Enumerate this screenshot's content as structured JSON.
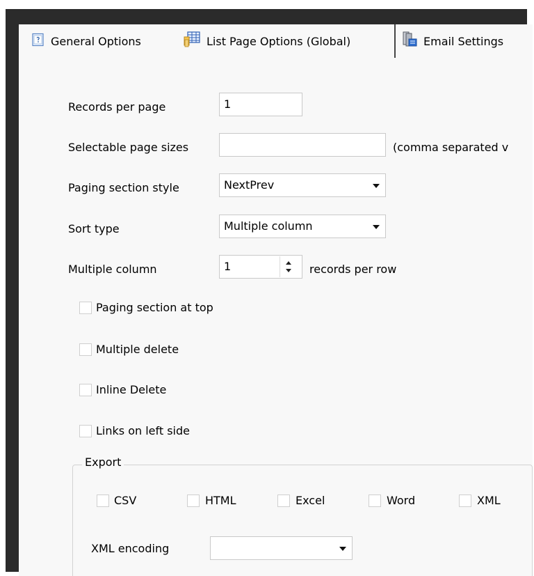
{
  "tabs": [
    {
      "label": "General Options",
      "icon": "document-help-icon"
    },
    {
      "label": "List Page Options (Global)",
      "icon": "grid-table-icon"
    },
    {
      "label": "Email Settings",
      "icon": "email-server-icon"
    }
  ],
  "form": {
    "records_per_page": {
      "label": "Records per page",
      "value": "1"
    },
    "selectable_page_sizes": {
      "label": "Selectable page sizes",
      "value": "",
      "hint": "(comma separated v"
    },
    "paging_section_style": {
      "label": "Paging section style",
      "value": "NextPrev"
    },
    "sort_type": {
      "label": "Sort type",
      "value": "Multiple column"
    },
    "multiple_column": {
      "label": "Multiple column",
      "value": "1",
      "suffix": "records per row"
    },
    "checkboxes": [
      {
        "label": "Paging section at top",
        "checked": false
      },
      {
        "label": "Multiple delete",
        "checked": false
      },
      {
        "label": "Inline Delete",
        "checked": false
      },
      {
        "label": "Links on left side",
        "checked": false
      }
    ]
  },
  "export": {
    "title": "Export",
    "options": [
      {
        "label": "CSV",
        "checked": false
      },
      {
        "label": "HTML",
        "checked": false
      },
      {
        "label": "Excel",
        "checked": false
      },
      {
        "label": "Word",
        "checked": false
      },
      {
        "label": "XML",
        "checked": false
      }
    ],
    "xml_encoding": {
      "label": "XML encoding",
      "value": ""
    }
  },
  "colors": {
    "frame": "#2b2b2b",
    "panel_background": "#f8f8f8",
    "control_border": "#c9c9c9"
  }
}
